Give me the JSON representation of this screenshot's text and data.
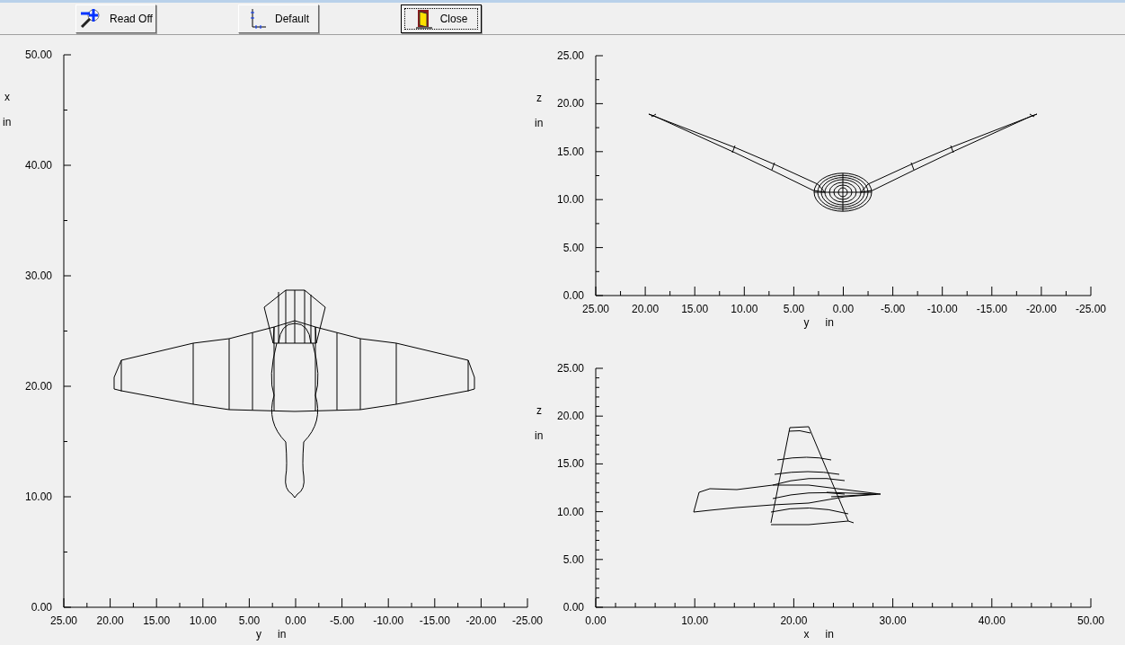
{
  "toolbar": {
    "buttons": [
      {
        "label": "Read Off",
        "kind": "readoff",
        "focused": false
      },
      {
        "label": "Default",
        "kind": "default",
        "focused": false
      },
      {
        "label": "Close",
        "kind": "close",
        "focused": true
      }
    ]
  },
  "plots": [
    {
      "kind": "top",
      "y_label": "x",
      "y_unit": "in",
      "x_label": "y",
      "x_unit": "in",
      "y_ticks": [
        "50.00",
        "40.00",
        "30.00",
        "20.00",
        "10.00",
        "0.00"
      ],
      "x_ticks": [
        "25.00",
        "20.00",
        "15.00",
        "10.00",
        "5.00",
        "0.00",
        "-5.00",
        "-10.00",
        "-15.00",
        "-20.00",
        "-25.00"
      ]
    },
    {
      "kind": "front",
      "y_label": "z",
      "y_unit": "in",
      "x_label": "y",
      "x_unit": "in",
      "y_ticks": [
        "25.00",
        "20.00",
        "15.00",
        "10.00",
        "5.00",
        "0.00"
      ],
      "x_ticks": [
        "25.00",
        "20.00",
        "15.00",
        "10.00",
        "5.00",
        "0.00",
        "-5.00",
        "-10.00",
        "-15.00",
        "-20.00",
        "-25.00"
      ]
    },
    {
      "kind": "side",
      "y_label": "z",
      "y_unit": "in",
      "x_label": "x",
      "x_unit": "in",
      "y_ticks": [
        "25.00",
        "20.00",
        "15.00",
        "10.00",
        "5.00",
        "0.00"
      ],
      "x_ticks": [
        "0.00",
        "10.00",
        "20.00",
        "30.00",
        "40.00",
        "50.00"
      ]
    }
  ]
}
